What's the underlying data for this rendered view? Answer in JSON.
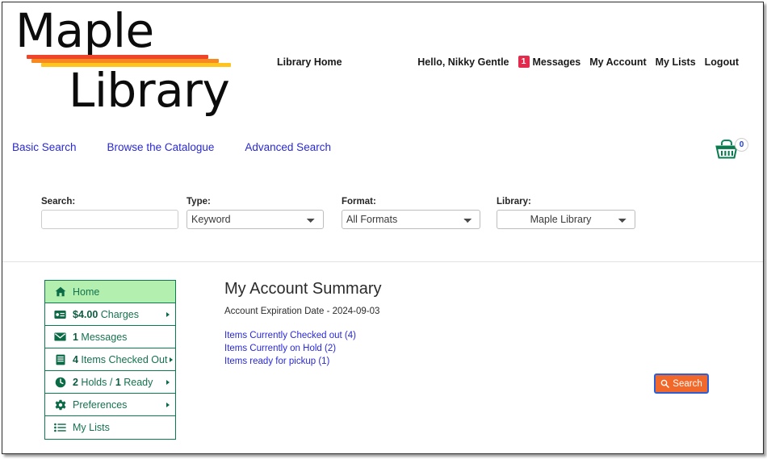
{
  "branding": {
    "name_line1": "Maple",
    "name_line2": "Library",
    "bar_red": "#f0452a",
    "bar_orange": "#f78a1e",
    "bar_yellow": "#ffc51e"
  },
  "header": {
    "library_home": "Library Home",
    "greeting": "Hello, Nikky Gentle",
    "messages_badge": "1",
    "messages_label": "Messages",
    "my_account": "My Account",
    "my_lists": "My Lists",
    "logout": "Logout"
  },
  "nav": {
    "basic_search": "Basic Search",
    "browse_catalogue": "Browse the Catalogue",
    "advanced_search": "Advanced Search",
    "basket_count": "0",
    "basket_icon": "basket-icon"
  },
  "search": {
    "search_label": "Search:",
    "search_value": "",
    "search_placeholder": "",
    "type_label": "Type:",
    "type_value": "Keyword",
    "type_options": [
      "Keyword"
    ],
    "format_label": "Format:",
    "format_value": "All Formats",
    "format_options": [
      "All Formats"
    ],
    "library_label": "Library:",
    "library_value": "Maple Library",
    "library_options": [
      "Maple Library"
    ],
    "submit_label": "Search",
    "submit_icon": "search-icon",
    "submit_color": "#f2682a",
    "focus_outline_color": "#2b5fd9"
  },
  "sidebar": {
    "accent_color": "#0a7a4f",
    "active_bg": "#b3efae",
    "items": [
      {
        "icon": "home-icon",
        "label": "Home",
        "bold_prefix": "",
        "caret": false,
        "active": true
      },
      {
        "icon": "money-bill-icon",
        "label": " Charges",
        "bold_prefix": "$4.00",
        "caret": true,
        "active": false
      },
      {
        "icon": "envelope-icon",
        "label": " Messages",
        "bold_prefix": "1",
        "caret": false,
        "active": false
      },
      {
        "icon": "book-icon",
        "label": " Items Checked Out",
        "bold_prefix": "4",
        "caret": true,
        "active": false
      },
      {
        "icon": "clock-icon",
        "label": " Holds / ",
        "bold_prefix": "2",
        "bold_mid": "1",
        "label_tail": " Ready",
        "caret": true,
        "active": false
      },
      {
        "icon": "gear-icon",
        "label": "Preferences",
        "bold_prefix": "",
        "caret": true,
        "active": false
      },
      {
        "icon": "list-icon",
        "label": "My Lists",
        "bold_prefix": "",
        "caret": false,
        "active": false
      }
    ]
  },
  "main": {
    "title": "My Account Summary",
    "expiration": "Account Expiration Date - 2024-09-03",
    "links": [
      "Items Currently Checked out (4)",
      "Items Currently on Hold (2)",
      "Items ready for pickup (1)"
    ]
  }
}
